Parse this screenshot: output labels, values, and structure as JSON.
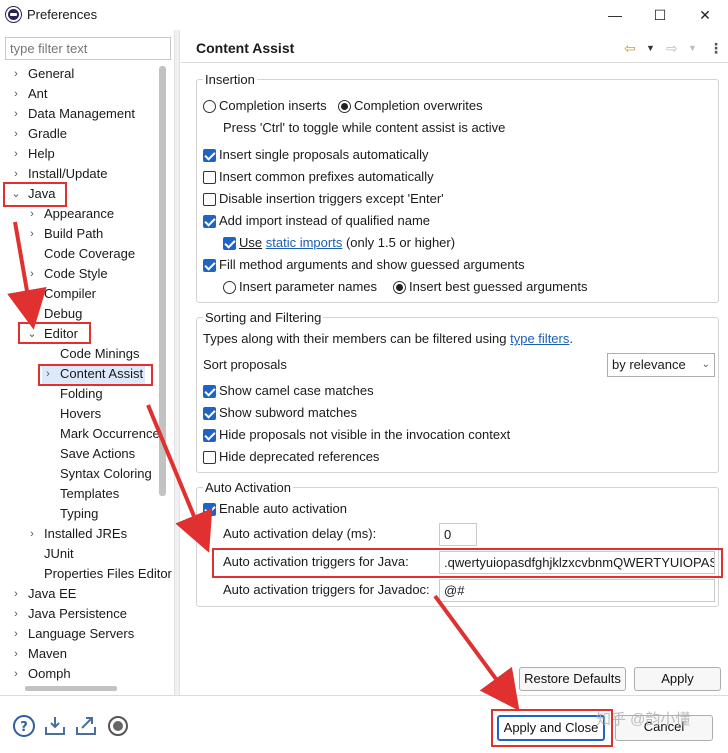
{
  "window": {
    "title": "Preferences",
    "minimize": "—",
    "maximize": "☐",
    "close": "✕"
  },
  "filter": {
    "placeholder": "type filter text"
  },
  "tree": [
    {
      "label": "General",
      "level": 0,
      "tw": ">"
    },
    {
      "label": "Ant",
      "level": 0,
      "tw": ">"
    },
    {
      "label": "Data Management",
      "level": 0,
      "tw": ">"
    },
    {
      "label": "Gradle",
      "level": 0,
      "tw": ">"
    },
    {
      "label": "Help",
      "level": 0,
      "tw": ">"
    },
    {
      "label": "Install/Update",
      "level": 0,
      "tw": ">"
    },
    {
      "label": "Java",
      "level": 0,
      "tw": "v"
    },
    {
      "label": "Appearance",
      "level": 1,
      "tw": ">"
    },
    {
      "label": "Build Path",
      "level": 1,
      "tw": ">"
    },
    {
      "label": "Code Coverage",
      "level": 1,
      "tw": ""
    },
    {
      "label": "Code Style",
      "level": 1,
      "tw": ">"
    },
    {
      "label": "Compiler",
      "level": 1,
      "tw": ">"
    },
    {
      "label": "Debug",
      "level": 1,
      "tw": ">"
    },
    {
      "label": "Editor",
      "level": 1,
      "tw": "v"
    },
    {
      "label": "Code Minings",
      "level": 2,
      "tw": ""
    },
    {
      "label": "Content Assist",
      "level": 2,
      "tw": ">",
      "selected": true
    },
    {
      "label": "Folding",
      "level": 2,
      "tw": ""
    },
    {
      "label": "Hovers",
      "level": 2,
      "tw": ""
    },
    {
      "label": "Mark Occurrences",
      "level": 2,
      "tw": ""
    },
    {
      "label": "Save Actions",
      "level": 2,
      "tw": ""
    },
    {
      "label": "Syntax Coloring",
      "level": 2,
      "tw": ""
    },
    {
      "label": "Templates",
      "level": 2,
      "tw": ""
    },
    {
      "label": "Typing",
      "level": 2,
      "tw": ""
    },
    {
      "label": "Installed JREs",
      "level": 1,
      "tw": ">"
    },
    {
      "label": "JUnit",
      "level": 1,
      "tw": ""
    },
    {
      "label": "Properties Files Editor",
      "level": 1,
      "tw": ""
    },
    {
      "label": "Java EE",
      "level": 0,
      "tw": ">"
    },
    {
      "label": "Java Persistence",
      "level": 0,
      "tw": ">"
    },
    {
      "label": "Language Servers",
      "level": 0,
      "tw": ">"
    },
    {
      "label": "Maven",
      "level": 0,
      "tw": ">"
    },
    {
      "label": "Oomph",
      "level": 0,
      "tw": ">"
    }
  ],
  "page": {
    "title": "Content Assist"
  },
  "insertion": {
    "label": "Insertion",
    "completion_inserts": "Completion inserts",
    "completion_overwrites": "Completion overwrites",
    "ctrl_hint": "Press 'Ctrl' to toggle while content assist is active",
    "insert_single": "Insert single proposals automatically",
    "insert_common": "Insert common prefixes automatically",
    "disable_triggers": "Disable insertion triggers except 'Enter'",
    "add_import": "Add import instead of qualified name",
    "use": "Use",
    "static_imports": "static imports",
    "only_15": "(only 1.5 or higher)",
    "fill_method": "Fill method arguments and show guessed arguments",
    "insert_param_names": "Insert parameter names",
    "insert_best_guessed": "Insert best guessed arguments"
  },
  "sorting": {
    "label": "Sorting and Filtering",
    "types_text": "Types along with their members can be filtered using",
    "type_filters": "type filters",
    "period": ".",
    "sort_proposals": "Sort proposals",
    "sort_value": "by relevance",
    "show_camel": "Show camel case matches",
    "show_subword": "Show subword matches",
    "hide_not_visible": "Hide proposals not visible in the invocation context",
    "hide_deprecated": "Hide deprecated references"
  },
  "auto": {
    "label": "Auto Activation",
    "enable": "Enable auto activation",
    "delay_label": "Auto activation delay (ms):",
    "delay_value": "0",
    "java_label": "Auto activation triggers for Java:",
    "java_value": ".qwertyuiopasdfghjklzxcvbnmQWERTYUIOPASDFGHJKLZXCVBNM",
    "javadoc_label": "Auto activation triggers for Javadoc:",
    "javadoc_value": "@#"
  },
  "buttons": {
    "restore_defaults": "Restore Defaults",
    "apply": "Apply",
    "apply_close": "Apply and Close",
    "cancel": "Cancel"
  },
  "watermark": "知乎 @韵小懂",
  "colors": {
    "accent": "#1e64c8",
    "annotation": "#e03030",
    "selection": "#dbe9fb",
    "link": "#1a5fb4"
  }
}
